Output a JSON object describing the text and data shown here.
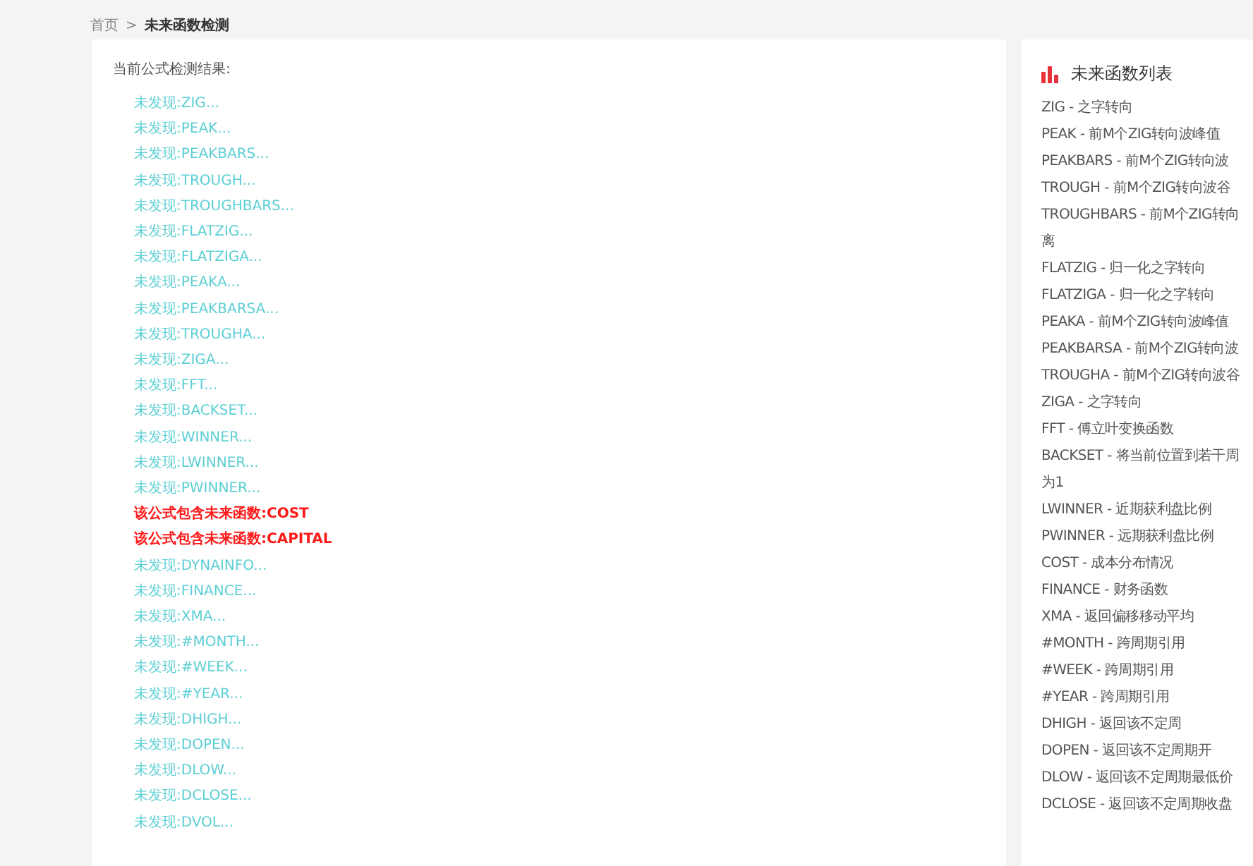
{
  "breadcrumb": {
    "home": "首页",
    "separator": ">",
    "current": "未来函数检测"
  },
  "results": {
    "heading": "当前公式检测结果:",
    "items": [
      {
        "text": "未发现:ZIG...",
        "kind": "ok"
      },
      {
        "text": "未发现:PEAK...",
        "kind": "ok"
      },
      {
        "text": "未发现:PEAKBARS...",
        "kind": "ok"
      },
      {
        "text": "未发现:TROUGH...",
        "kind": "ok"
      },
      {
        "text": "未发现:TROUGHBARS...",
        "kind": "ok"
      },
      {
        "text": "未发现:FLATZIG...",
        "kind": "ok"
      },
      {
        "text": "未发现:FLATZIGA...",
        "kind": "ok"
      },
      {
        "text": "未发现:PEAKA...",
        "kind": "ok"
      },
      {
        "text": "未发现:PEAKBARSA...",
        "kind": "ok"
      },
      {
        "text": "未发现:TROUGHA...",
        "kind": "ok"
      },
      {
        "text": "未发现:ZIGA...",
        "kind": "ok"
      },
      {
        "text": "未发现:FFT...",
        "kind": "ok"
      },
      {
        "text": "未发现:BACKSET...",
        "kind": "ok"
      },
      {
        "text": "未发现:WINNER...",
        "kind": "ok"
      },
      {
        "text": "未发现:LWINNER...",
        "kind": "ok"
      },
      {
        "text": "未发现:PWINNER...",
        "kind": "ok"
      },
      {
        "text": "该公式包含未来函数:COST",
        "kind": "future"
      },
      {
        "text": "该公式包含未来函数:CAPITAL",
        "kind": "future"
      },
      {
        "text": "未发现:DYNAINFO...",
        "kind": "ok"
      },
      {
        "text": "未发现:FINANCE...",
        "kind": "ok"
      },
      {
        "text": "未发现:XMA...",
        "kind": "ok"
      },
      {
        "text": "未发现:#MONTH...",
        "kind": "ok"
      },
      {
        "text": "未发现:#WEEK...",
        "kind": "ok"
      },
      {
        "text": "未发现:#YEAR...",
        "kind": "ok"
      },
      {
        "text": "未发现:DHIGH...",
        "kind": "ok"
      },
      {
        "text": "未发现:DOPEN...",
        "kind": "ok"
      },
      {
        "text": "未发现:DLOW...",
        "kind": "ok"
      },
      {
        "text": "未发现:DCLOSE...",
        "kind": "ok"
      },
      {
        "text": "未发现:DVOL...",
        "kind": "ok"
      }
    ]
  },
  "function_list": {
    "title": "未来函数列表",
    "lines": [
      "ZIG - 之字转向",
      "PEAK - 前M个ZIG转向波峰值",
      "PEAKBARS - 前M个ZIG转向波",
      "TROUGH - 前M个ZIG转向波谷",
      "TROUGHBARS - 前M个ZIG转向",
      "离",
      "FLATZIG - 归一化之字转向",
      "FLATZIGA - 归一化之字转向",
      "PEAKA - 前M个ZIG转向波峰值",
      "PEAKBARSA - 前M个ZIG转向波",
      "TROUGHA - 前M个ZIG转向波谷",
      "ZIGA - 之字转向",
      "FFT - 傅立叶变换函数",
      "BACKSET - 将当前位置到若干周",
      "为1",
      "LWINNER - 近期获利盘比例",
      "PWINNER - 远期获利盘比例",
      "COST - 成本分布情况",
      "FINANCE - 财务函数",
      "XMA - 返回偏移移动平均",
      "#MONTH - 跨周期引用",
      "#WEEK - 跨周期引用",
      "#YEAR - 跨周期引用",
      "DHIGH - 返回该不定周",
      "DOPEN - 返回该不定周期开",
      "DLOW - 返回该不定周期最低价",
      "DCLOSE - 返回该不定周期收盘"
    ]
  }
}
